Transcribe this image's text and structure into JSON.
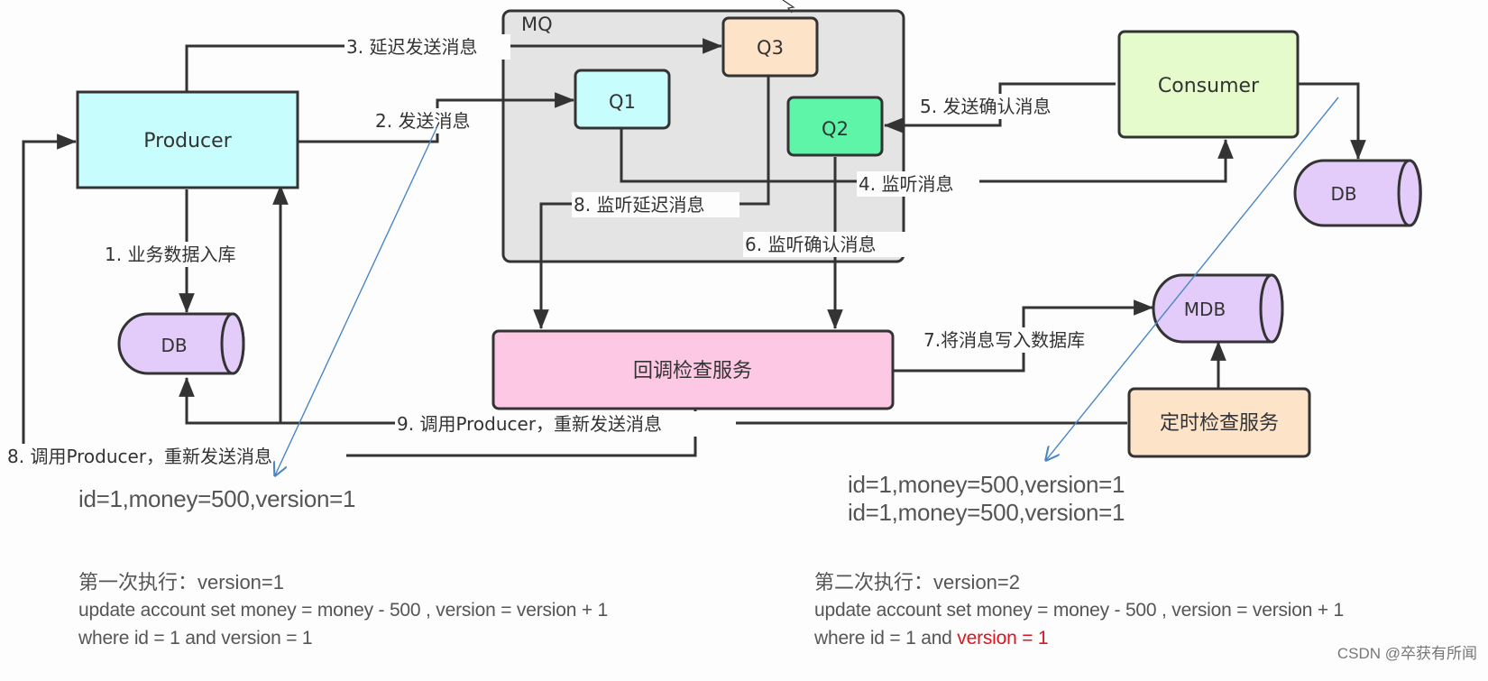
{
  "diagram": {
    "nodes": {
      "mq": "MQ",
      "producer": "Producer",
      "q1": "Q1",
      "q2": "Q2",
      "q3": "Q3",
      "consumer": "Consumer",
      "db_left": "DB",
      "db_right": "DB",
      "mdb": "MDB",
      "callback_service": "回调检查服务",
      "timer_service": "定时检查服务"
    },
    "edges": {
      "e1": "1. 业务数据入库",
      "e2": "2. 发送消息",
      "e3": "3. 延迟发送消息",
      "e4": "4. 监听消息",
      "e5": "5. 发送确认消息",
      "e6": "6. 监听确认消息",
      "e7": "7.将消息写入数据库",
      "e8a": "8. 监听延迟消息",
      "e8b": "8. 调用Producer，重新发送消息",
      "e9": "9. 调用Producer，重新发送消息"
    },
    "colors": {
      "producer": "#c8fdfd",
      "q1": "#c8fdfd",
      "q2": "#5ef5a8",
      "q3": "#fde3c8",
      "consumer": "#e5fbcb",
      "db": "#e3ccfa",
      "callback": "#fdc8e3",
      "timer": "#fde3c8",
      "mq": "#e4e4e4",
      "annotation_line": "#4a86c5",
      "highlight": "#e0141e"
    }
  },
  "notes": {
    "left_record": "id=1,money=500,version=1",
    "right_records": [
      "id=1,money=500,version=1",
      "id=1,money=500,version=1"
    ],
    "first_exec": {
      "title": "第一次执行：version=1",
      "line1": "update account set money = money - 500 , version = version + 1",
      "line2": "where id = 1 and version = 1"
    },
    "second_exec": {
      "title": "第二次执行：version=2",
      "line1": "update account set money = money - 500 , version = version + 1",
      "line2_prefix": "where id = 1 and ",
      "line2_highlight": "version = 1"
    }
  },
  "watermark": "CSDN @卒获有所闻"
}
